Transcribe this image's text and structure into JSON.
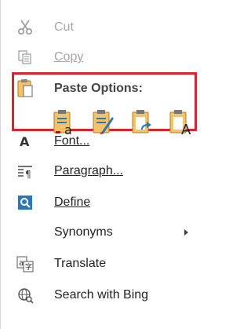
{
  "menu": {
    "cut": "Cut",
    "copy": "Copy",
    "paste_options": "Paste Options:",
    "font": "Font...",
    "paragraph": "Paragraph...",
    "define": "Define",
    "synonyms": "Synonyms",
    "translate": "Translate",
    "search": "Search with Bing"
  },
  "icons": {
    "cut": "scissors-icon",
    "copy": "copy-icon",
    "paste": "clipboard-icon",
    "paste_keep_source": "paste-keep-source-formatting-icon",
    "paste_merge": "paste-merge-formatting-icon",
    "paste_picture": "paste-picture-icon",
    "paste_text_only": "paste-keep-text-only-icon",
    "font": "font-icon",
    "paragraph": "paragraph-icon",
    "define": "define-icon",
    "translate": "translate-icon",
    "search": "search-globe-icon"
  },
  "colors": {
    "highlight_border": "#d9232e",
    "disabled_text": "#a6a6a6",
    "accent_blue": "#2e75b6"
  }
}
